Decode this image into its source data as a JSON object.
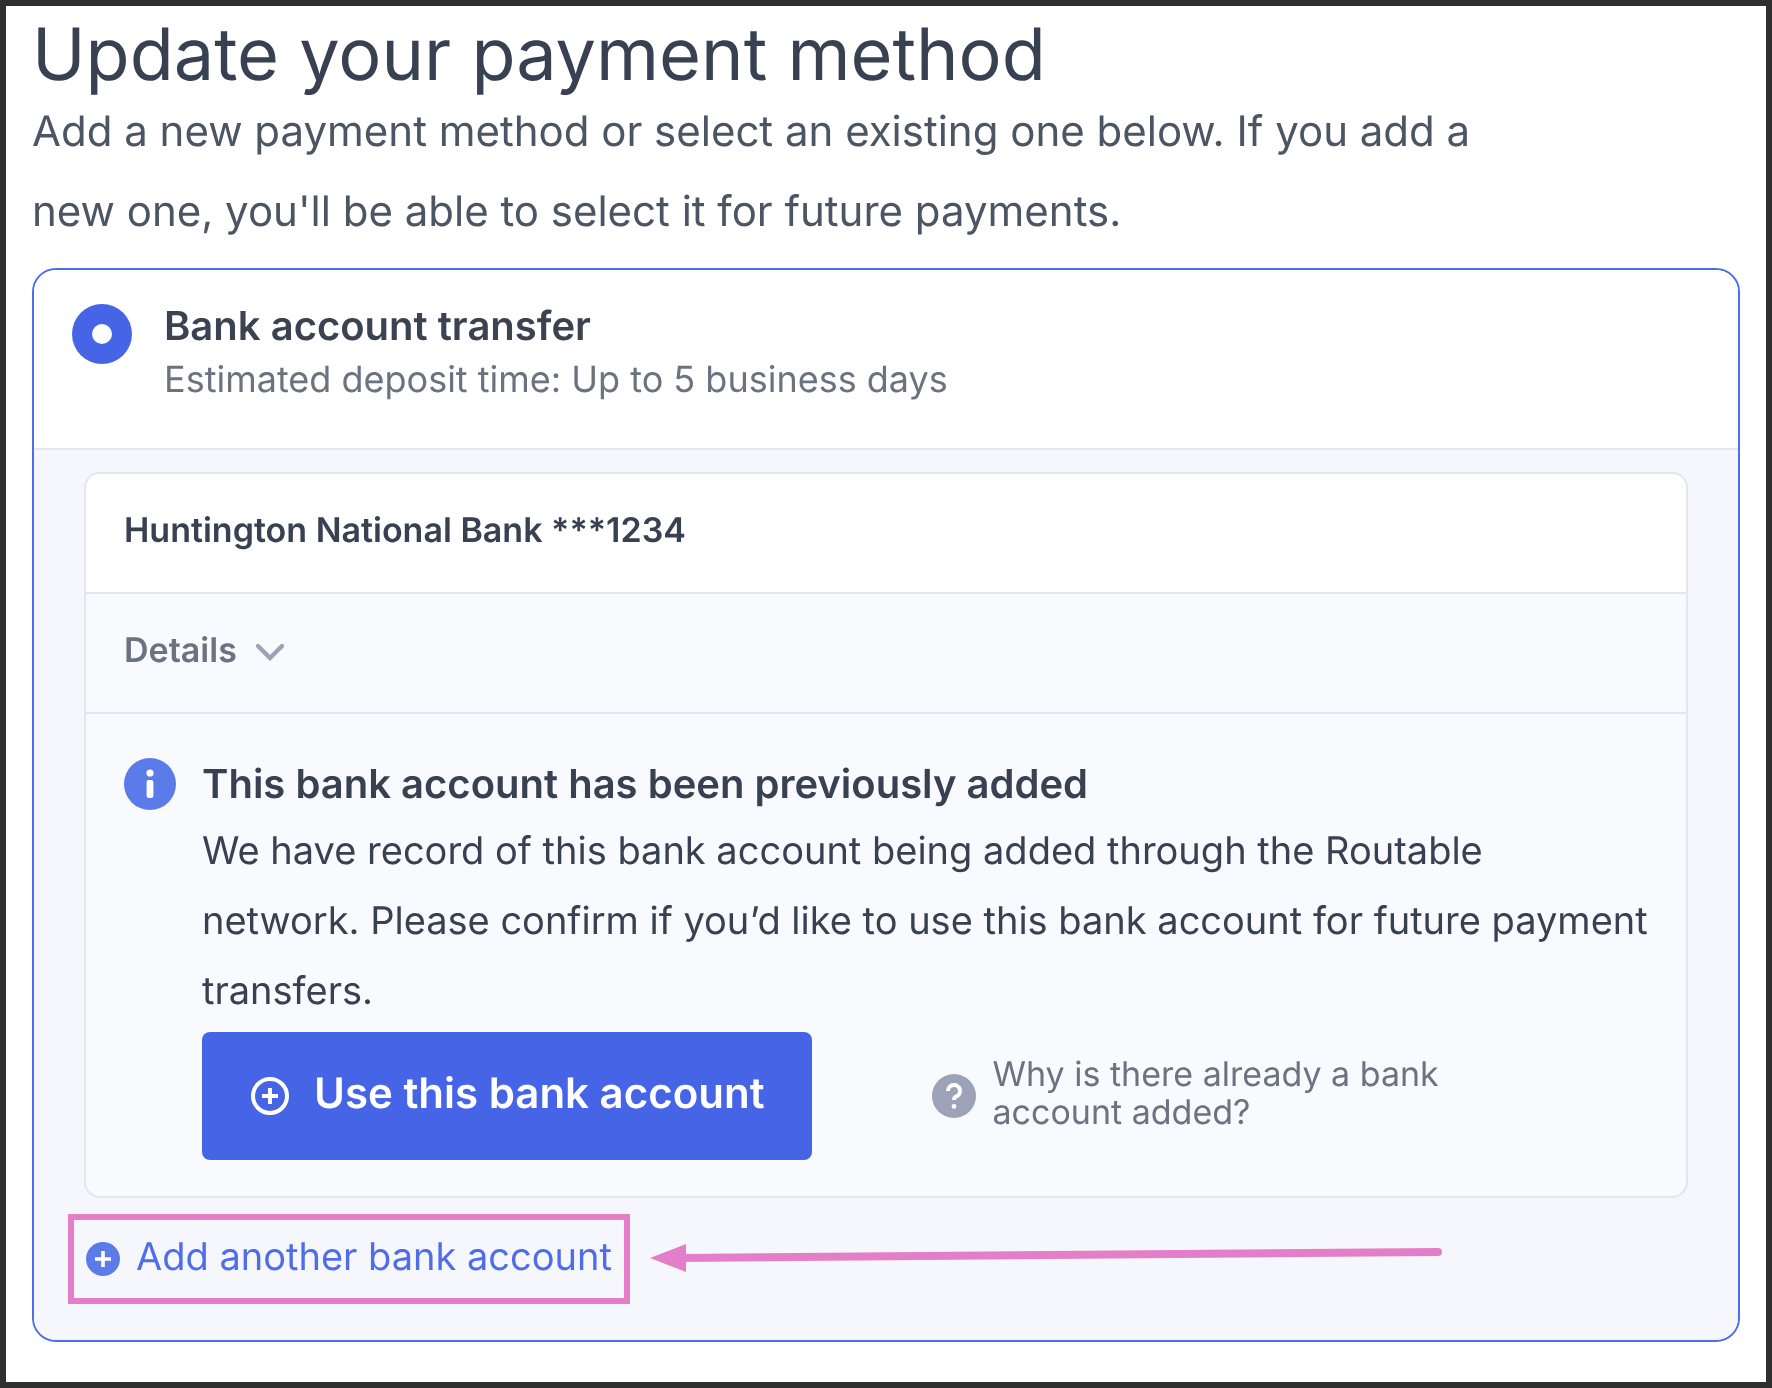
{
  "title": "Update your payment method",
  "subtitle": "Add a new payment method or select an existing one below. If you add a new one, you'll be able to select it for future payments.",
  "payment_option": {
    "title": "Bank account transfer",
    "subtitle": "Estimated deposit time: Up to 5 business days",
    "selected": true
  },
  "account": {
    "name": "Huntington National Bank ***1234",
    "details_label": "Details",
    "expanded": false
  },
  "notice": {
    "title": "This bank account has been previously added",
    "body": "We have record of this bank account being added through the Routable network. Please confirm if you’d like to use this bank account for future payment transfers.",
    "button": "Use this bank account",
    "help_link": "Why is there already a bank account added?"
  },
  "add_link": "Add another bank account"
}
